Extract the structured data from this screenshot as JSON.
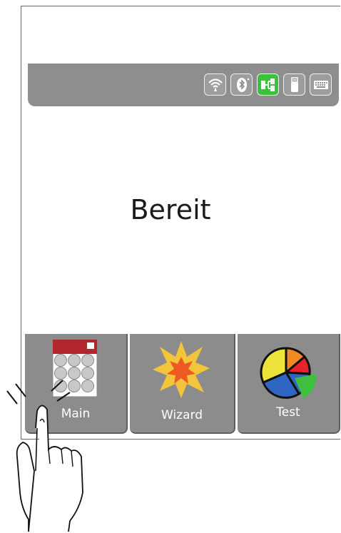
{
  "status": {
    "text": "Bereit"
  },
  "indicators": [
    {
      "icon": "wifi-icon",
      "active": false
    },
    {
      "icon": "bluetooth-icon",
      "active": false
    },
    {
      "icon": "network-icon",
      "active": true
    },
    {
      "icon": "usb-stick-icon",
      "active": false
    },
    {
      "icon": "keyboard-icon",
      "active": false
    }
  ],
  "tiles": {
    "main": {
      "label": "Main",
      "icon": "keypad-icon"
    },
    "wizard": {
      "label": "Wizard",
      "icon": "starburst-icon"
    },
    "test": {
      "label": "Test",
      "icon": "pie-chart-icon"
    }
  },
  "colors": {
    "bar_gray": "#8e8e8e",
    "active_green": "#3cc13c",
    "tile_gray": "#8c8c8c"
  }
}
